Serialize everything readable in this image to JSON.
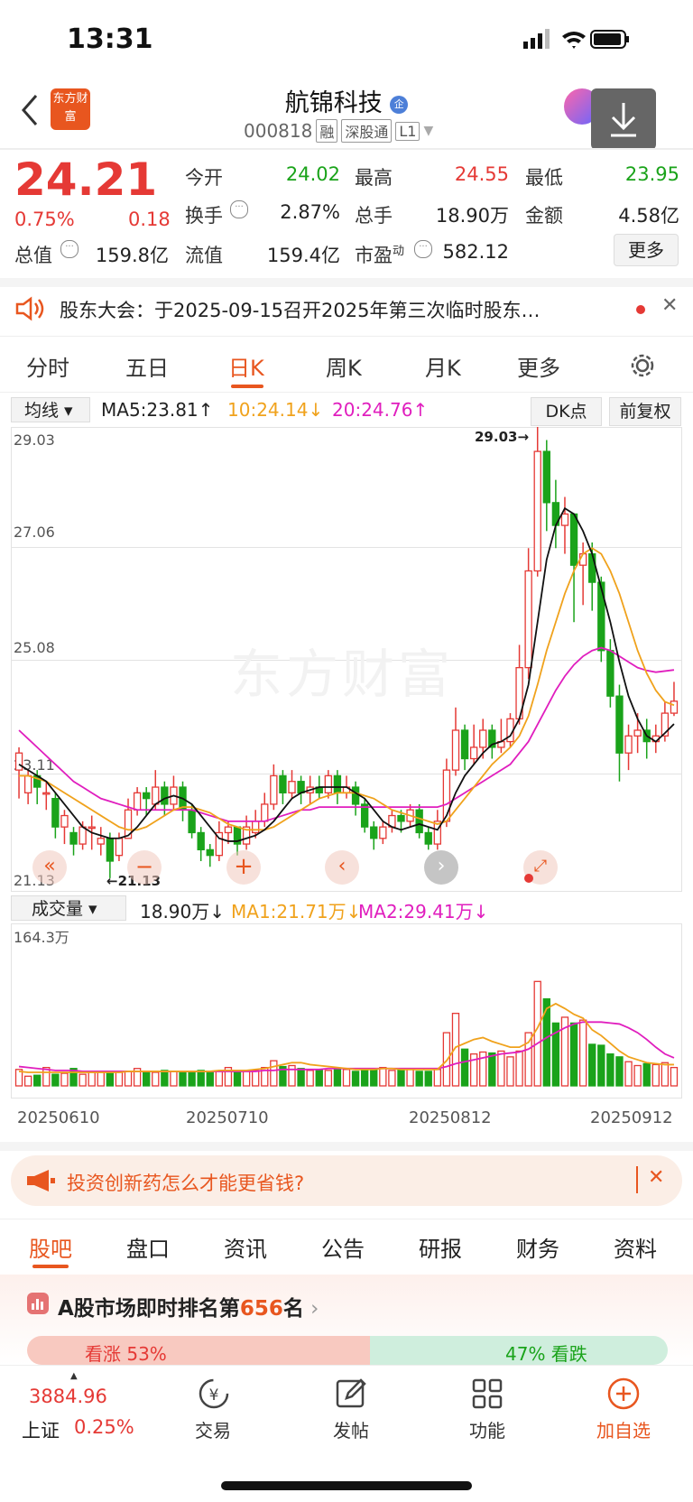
{
  "status": {
    "time": "13:31"
  },
  "header": {
    "title": "航锦科技",
    "code": "000818",
    "tags": [
      "融",
      "深股通",
      "L1"
    ],
    "logo_text": "东方财富"
  },
  "quote": {
    "price": "24.21",
    "change_pct": "0.75%",
    "change": "0.18",
    "open_label": "今开",
    "open": "24.02",
    "high_label": "最高",
    "high": "24.55",
    "low_label": "最低",
    "low": "23.95",
    "turnover_label": "换手",
    "turnover": "2.87%",
    "volume_label": "总手",
    "volume": "18.90万",
    "amount_label": "金额",
    "amount": "4.58亿",
    "mktcap_label": "总值",
    "mktcap": "159.8亿",
    "float_label": "流值",
    "float": "159.4亿",
    "pe_label": "市盈",
    "pe_sup": "动",
    "pe": "582.12",
    "more": "更多"
  },
  "notice": {
    "text": "股东大会：于2025-09-15召开2025年第三次临时股东…"
  },
  "tabs": [
    "分时",
    "五日",
    "日K",
    "周K",
    "月K",
    "更多"
  ],
  "active_tab": "日K",
  "kline": {
    "ma_selector": "均线",
    "ma5": "MA5:23.81↑",
    "ma10": "10:24.14↓",
    "ma20": "20:24.76↑",
    "dk_button": "DK点",
    "adjust_button": "前复权",
    "y_labels": [
      "29.03",
      "27.06",
      "25.08",
      "23.11",
      "21.13"
    ],
    "max_marker": "29.03→",
    "min_marker": "←21.13",
    "watermark": "东方财富"
  },
  "volume": {
    "selector": "成交量",
    "vol": "18.90万↓",
    "ma1": "MA1:21.71万↓",
    "ma2": "MA2:29.41万↓",
    "max_label": "164.3万",
    "dates": [
      "20250610",
      "20250710",
      "20250812",
      "20250912"
    ]
  },
  "chart_data": {
    "type": "candlestick",
    "ylim": [
      21.13,
      29.03
    ],
    "candles": [
      [
        23.0,
        23.3,
        22.7,
        22.5,
        23.4
      ],
      [
        22.6,
        22.9,
        22.5,
        22.4,
        23.0
      ],
      [
        22.9,
        22.7,
        22.6,
        22.4,
        23.0
      ],
      [
        22.6,
        22.6,
        22.5,
        22.3,
        22.8
      ],
      [
        22.5,
        22.0,
        21.9,
        21.8,
        22.6
      ],
      [
        22.0,
        22.2,
        22.0,
        21.7,
        22.3
      ],
      [
        21.9,
        21.7,
        21.6,
        21.5,
        22.0
      ],
      [
        21.7,
        22.0,
        21.9,
        21.6,
        22.1
      ],
      [
        22.0,
        22.0,
        21.7,
        21.6,
        22.2
      ],
      [
        21.7,
        21.8,
        21.6,
        21.5,
        22.0
      ],
      [
        21.8,
        21.4,
        21.3,
        21.1,
        21.9
      ],
      [
        21.5,
        21.8,
        21.8,
        21.4,
        21.9
      ],
      [
        21.8,
        22.3,
        22.3,
        21.8,
        22.5
      ],
      [
        22.3,
        22.6,
        22.6,
        22.2,
        22.7
      ],
      [
        22.6,
        22.5,
        22.4,
        22.2,
        22.7
      ],
      [
        22.4,
        22.7,
        22.7,
        22.3,
        23.0
      ],
      [
        22.7,
        22.4,
        22.4,
        22.2,
        22.8
      ],
      [
        22.4,
        22.7,
        22.7,
        22.3,
        22.9
      ],
      [
        22.7,
        22.3,
        22.3,
        22.1,
        22.8
      ],
      [
        22.3,
        21.9,
        21.9,
        21.8,
        22.4
      ],
      [
        21.9,
        21.6,
        21.5,
        21.4,
        22.0
      ],
      [
        21.6,
        21.5,
        21.4,
        21.3,
        21.7
      ],
      [
        21.5,
        21.9,
        21.9,
        21.4,
        22.1
      ],
      [
        21.9,
        22.0,
        21.9,
        21.7,
        22.1
      ],
      [
        22.0,
        21.7,
        21.6,
        21.5,
        22.0
      ],
      [
        21.7,
        22.0,
        21.9,
        21.6,
        22.2
      ],
      [
        21.9,
        22.1,
        22.1,
        21.8,
        22.3
      ],
      [
        22.1,
        22.4,
        22.4,
        22.0,
        22.6
      ],
      [
        22.4,
        22.9,
        22.9,
        22.3,
        23.1
      ],
      [
        22.9,
        22.6,
        22.6,
        22.4,
        23.0
      ],
      [
        22.6,
        22.8,
        22.8,
        22.5,
        23.0
      ],
      [
        22.8,
        22.6,
        22.6,
        22.4,
        22.9
      ],
      [
        22.6,
        22.7,
        22.7,
        22.4,
        22.9
      ],
      [
        22.7,
        22.6,
        22.6,
        22.5,
        22.9
      ],
      [
        22.6,
        22.9,
        22.9,
        22.5,
        23.0
      ],
      [
        22.9,
        22.6,
        22.6,
        22.4,
        23.0
      ],
      [
        22.6,
        22.7,
        22.7,
        22.5,
        22.9
      ],
      [
        22.7,
        22.4,
        22.4,
        22.2,
        22.8
      ],
      [
        22.4,
        22.0,
        22.0,
        21.9,
        22.5
      ],
      [
        22.0,
        21.8,
        21.8,
        21.6,
        22.1
      ],
      [
        21.8,
        22.0,
        22.0,
        21.7,
        22.1
      ],
      [
        22.0,
        22.2,
        22.2,
        21.9,
        22.3
      ],
      [
        22.2,
        22.1,
        22.1,
        21.9,
        22.3
      ],
      [
        22.1,
        22.3,
        22.3,
        22.0,
        22.4
      ],
      [
        22.3,
        21.9,
        21.9,
        21.8,
        22.4
      ],
      [
        21.9,
        21.7,
        21.7,
        21.6,
        22.0
      ],
      [
        21.7,
        22.1,
        22.1,
        21.6,
        22.3
      ],
      [
        22.1,
        23.0,
        23.0,
        22.0,
        23.2
      ],
      [
        23.0,
        23.7,
        23.7,
        22.9,
        24.1
      ],
      [
        23.7,
        23.2,
        23.2,
        23.0,
        23.8
      ],
      [
        23.2,
        23.4,
        23.4,
        23.1,
        23.8
      ],
      [
        23.4,
        23.7,
        23.7,
        23.2,
        23.9
      ],
      [
        23.7,
        23.4,
        23.4,
        23.2,
        23.8
      ],
      [
        23.4,
        23.5,
        23.5,
        23.3,
        23.9
      ],
      [
        23.5,
        23.9,
        23.9,
        23.4,
        24.0
      ],
      [
        23.9,
        24.8,
        24.8,
        23.8,
        25.2
      ],
      [
        24.8,
        26.5,
        26.5,
        24.6,
        26.9
      ],
      [
        26.5,
        28.6,
        28.6,
        26.4,
        29.03
      ],
      [
        28.6,
        27.7,
        27.7,
        27.2,
        28.8
      ],
      [
        27.7,
        27.3,
        27.3,
        26.9,
        28.1
      ],
      [
        27.3,
        27.5,
        27.5,
        26.8,
        27.8
      ],
      [
        27.5,
        26.6,
        26.6,
        25.6,
        27.1
      ],
      [
        26.6,
        26.8,
        26.8,
        25.9,
        27.0
      ],
      [
        26.8,
        26.3,
        26.3,
        25.8,
        27.0
      ],
      [
        26.3,
        25.1,
        25.1,
        24.9,
        26.4
      ],
      [
        25.1,
        24.3,
        24.3,
        24.1,
        25.3
      ],
      [
        24.3,
        23.3,
        23.3,
        22.8,
        24.5
      ],
      [
        23.3,
        23.6,
        23.6,
        23.0,
        23.8
      ],
      [
        23.6,
        23.7,
        23.7,
        23.3,
        24.0
      ],
      [
        23.7,
        23.5,
        23.5,
        23.2,
        23.9
      ],
      [
        23.5,
        23.6,
        23.6,
        23.3,
        23.8
      ],
      [
        23.6,
        24.0,
        24.0,
        23.5,
        24.2
      ],
      [
        24.0,
        24.21,
        24.21,
        23.95,
        24.55
      ]
    ],
    "ma5": [
      23.1,
      23.0,
      22.9,
      22.8,
      22.6,
      22.4,
      22.2,
      22.0,
      21.9,
      21.85,
      21.8,
      21.8,
      21.85,
      22.0,
      22.2,
      22.4,
      22.5,
      22.55,
      22.5,
      22.4,
      22.2,
      22.0,
      21.8,
      21.75,
      21.75,
      21.8,
      21.85,
      21.95,
      22.1,
      22.3,
      22.5,
      22.6,
      22.65,
      22.7,
      22.7,
      22.7,
      22.7,
      22.6,
      22.5,
      22.3,
      22.1,
      22.0,
      21.95,
      22.0,
      22.05,
      22.0,
      21.95,
      22.2,
      22.6,
      22.9,
      23.1,
      23.3,
      23.45,
      23.5,
      23.6,
      23.9,
      24.5,
      25.6,
      26.7,
      27.3,
      27.6,
      27.5,
      27.2,
      26.8,
      26.2,
      25.6,
      24.9,
      24.3,
      23.9,
      23.6,
      23.5,
      23.65,
      23.81
    ],
    "ma10": [
      22.9,
      22.9,
      22.85,
      22.8,
      22.7,
      22.6,
      22.5,
      22.4,
      22.3,
      22.2,
      22.1,
      22.0,
      21.95,
      21.95,
      22.0,
      22.1,
      22.2,
      22.3,
      22.35,
      22.35,
      22.3,
      22.25,
      22.15,
      22.05,
      22.0,
      21.95,
      21.95,
      21.95,
      22.0,
      22.1,
      22.2,
      22.3,
      22.4,
      22.5,
      22.55,
      22.6,
      22.6,
      22.6,
      22.55,
      22.5,
      22.4,
      22.3,
      22.25,
      22.2,
      22.15,
      22.1,
      22.05,
      22.1,
      22.3,
      22.5,
      22.7,
      22.9,
      23.1,
      23.25,
      23.4,
      23.6,
      23.95,
      24.5,
      25.1,
      25.6,
      26.1,
      26.5,
      26.8,
      26.9,
      26.8,
      26.5,
      26.1,
      25.6,
      25.1,
      24.7,
      24.4,
      24.2,
      24.14
    ],
    "ma20": [
      23.7,
      23.55,
      23.4,
      23.25,
      23.1,
      22.95,
      22.8,
      22.7,
      22.6,
      22.5,
      22.45,
      22.4,
      22.35,
      22.3,
      22.3,
      22.3,
      22.3,
      22.3,
      22.3,
      22.3,
      22.25,
      22.2,
      22.15,
      22.1,
      22.1,
      22.1,
      22.1,
      22.1,
      22.15,
      22.2,
      22.25,
      22.3,
      22.3,
      22.35,
      22.35,
      22.35,
      22.35,
      22.35,
      22.35,
      22.35,
      22.35,
      22.35,
      22.35,
      22.35,
      22.35,
      22.35,
      22.35,
      22.4,
      22.5,
      22.6,
      22.7,
      22.8,
      22.9,
      23.0,
      23.1,
      23.3,
      23.5,
      23.8,
      24.1,
      24.4,
      24.65,
      24.85,
      25.0,
      25.1,
      25.15,
      25.1,
      25.0,
      24.9,
      24.8,
      24.75,
      24.72,
      24.74,
      24.76
    ],
    "volume_max": 164.3,
    "volumes": [
      17,
      10,
      11,
      19,
      12,
      13,
      18,
      12,
      14,
      14,
      15,
      14,
      15,
      18,
      14,
      14,
      16,
      15,
      14,
      15,
      16,
      14,
      15,
      19,
      14,
      15,
      16,
      19,
      26,
      20,
      21,
      18,
      16,
      17,
      16,
      17,
      17,
      15,
      17,
      18,
      19,
      16,
      17,
      17,
      15,
      15,
      17,
      55,
      75,
      38,
      33,
      35,
      34,
      36,
      30,
      36,
      55,
      108,
      90,
      65,
      71,
      65,
      68,
      43,
      42,
      33,
      30,
      25,
      21,
      23,
      22,
      24,
      19
    ],
    "vol_ma1": [
      15,
      14,
      14,
      14,
      14,
      14,
      14,
      14,
      14,
      14,
      14,
      14,
      15,
      15,
      15,
      15,
      15,
      15,
      15,
      15,
      15,
      15,
      16,
      16,
      16,
      16,
      17,
      18,
      20,
      22,
      24,
      24,
      22,
      21,
      20,
      19,
      18,
      17,
      17,
      17,
      18,
      18,
      17,
      17,
      17,
      17,
      17,
      26,
      40,
      44,
      48,
      50,
      46,
      43,
      40,
      40,
      45,
      60,
      80,
      85,
      80,
      74,
      70,
      58,
      52,
      44,
      36,
      30,
      27,
      24,
      23,
      22,
      22
    ],
    "vol_ma2": [
      20,
      19,
      18,
      17,
      16,
      16,
      16,
      15,
      15,
      15,
      15,
      15,
      15,
      15,
      15,
      15,
      15,
      15,
      15,
      15,
      15,
      15,
      15,
      15,
      15,
      15,
      15,
      16,
      16,
      17,
      17,
      17,
      17,
      17,
      18,
      18,
      18,
      18,
      18,
      18,
      18,
      18,
      18,
      18,
      18,
      18,
      18,
      20,
      23,
      25,
      27,
      29,
      31,
      33,
      34,
      35,
      38,
      44,
      50,
      55,
      60,
      64,
      66,
      66,
      66,
      65,
      64,
      60,
      55,
      48,
      40,
      33,
      29
    ]
  },
  "bottom": {
    "ad_text": "投资创新药怎么才能更省钱?",
    "forum_tabs": [
      "股吧",
      "盘口",
      "资讯",
      "公告",
      "研报",
      "财务",
      "资料"
    ],
    "ranking_prefix": "A股市场即时排名第",
    "ranking_num": "656",
    "ranking_suffix": "名",
    "bull_text": "看涨 53%",
    "bear_text": "47% 看跌"
  },
  "nav": {
    "index_value": "3884.96",
    "index_name": "上证",
    "index_pct": "0.25%",
    "items": [
      "交易",
      "发帖",
      "功能",
      "加自选"
    ]
  }
}
